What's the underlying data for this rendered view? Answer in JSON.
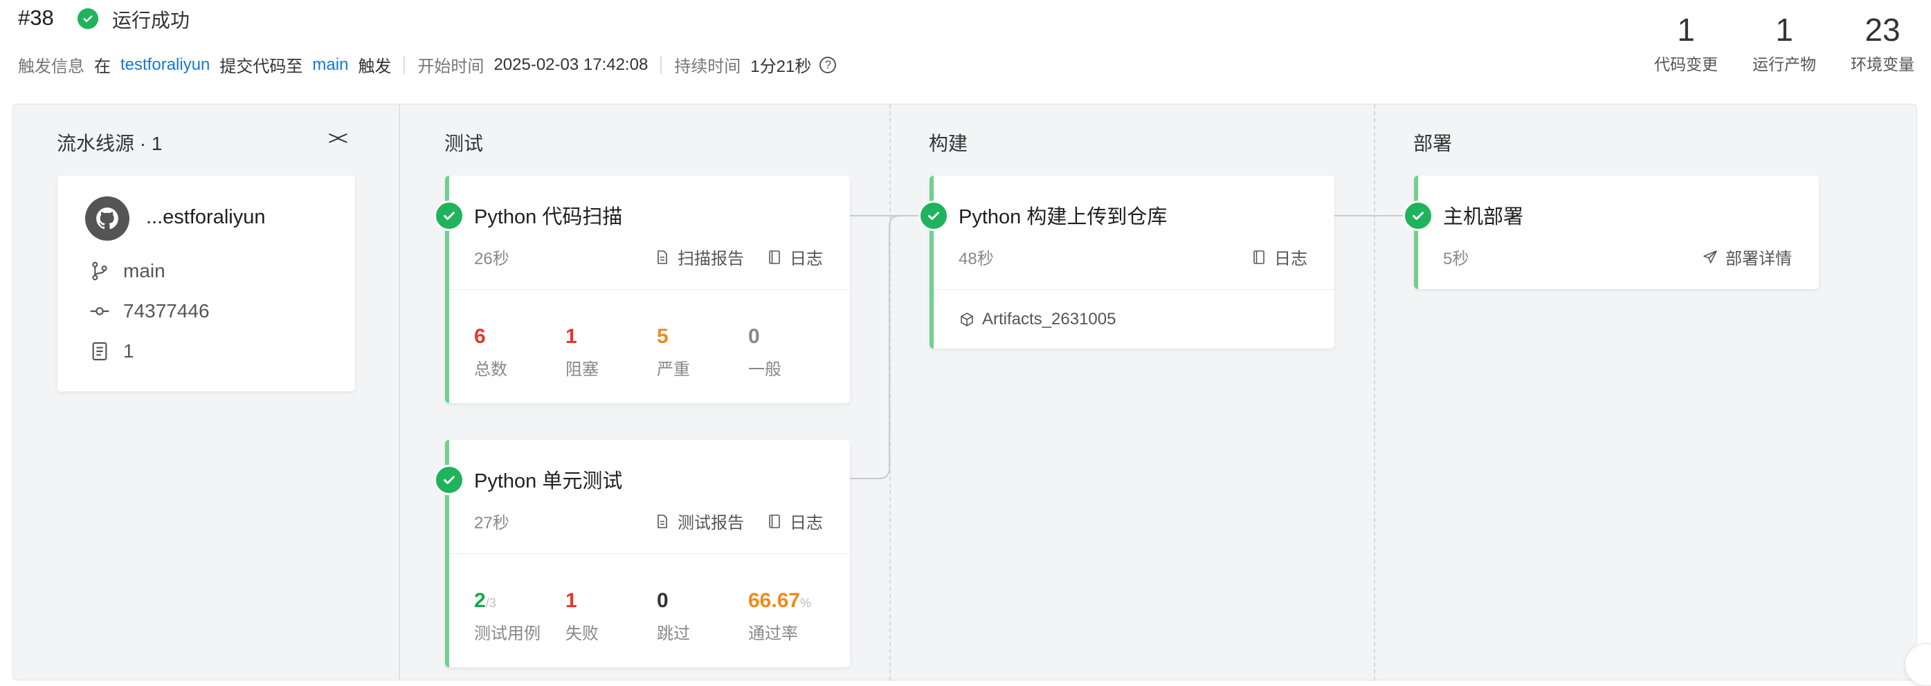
{
  "header": {
    "run_number": "#38",
    "status": "运行成功",
    "trigger_label": "触发信息",
    "trigger_prefix": "在",
    "trigger_repo": "testforaliyun",
    "trigger_middle": "提交代码至",
    "trigger_branch": "main",
    "trigger_suffix": "触发",
    "start_label": "开始时间",
    "start_time": "2025-02-03 17:42:08",
    "duration_label": "持续时间",
    "duration": "1分21秒",
    "help_glyph": "?",
    "stats": [
      {
        "value": "1",
        "label": "代码变更"
      },
      {
        "value": "1",
        "label": "运行产物"
      },
      {
        "value": "23",
        "label": "环境变量"
      }
    ]
  },
  "source": {
    "title": "流水线源 · 1",
    "collapse_glyph": "><",
    "repo_name": "...estforaliyun",
    "branch": "main",
    "commit": "74377446",
    "count": "1"
  },
  "stages": [
    {
      "title": "测试",
      "jobs": [
        {
          "name": "Python 代码扫描",
          "duration": "26秒",
          "actions": [
            "扫描报告",
            "日志"
          ],
          "metrics": [
            {
              "value": "6",
              "label": "总数",
              "color": "#e8352b"
            },
            {
              "value": "1",
              "label": "阻塞",
              "color": "#e8352b"
            },
            {
              "value": "5",
              "label": "严重",
              "color": "#f08a1d"
            },
            {
              "value": "0",
              "label": "一般",
              "color": "#888888"
            }
          ]
        },
        {
          "name": "Python 单元测试",
          "duration": "27秒",
          "actions": [
            "测试报告",
            "日志"
          ],
          "metrics": [
            {
              "value": "2",
              "suffix": "/3",
              "label": "测试用例",
              "color": "#1aa64a"
            },
            {
              "value": "1",
              "label": "失败",
              "color": "#e8352b"
            },
            {
              "value": "0",
              "label": "跳过",
              "color": "#333333"
            },
            {
              "value": "66.67",
              "suffix": "%",
              "label": "通过率",
              "color": "#f08a1d"
            }
          ]
        }
      ]
    },
    {
      "title": "构建",
      "jobs": [
        {
          "name": "Python 构建上传到仓库",
          "duration": "48秒",
          "actions": [
            "日志"
          ],
          "artifact": "Artifacts_2631005"
        }
      ]
    },
    {
      "title": "部署",
      "jobs": [
        {
          "name": "主机部署",
          "duration": "5秒",
          "actions": [
            "部署详情"
          ]
        }
      ]
    }
  ],
  "colors": {
    "success": "#1fb35c",
    "accent_link": "#1677d9",
    "stage_bar": "#6fd08c"
  }
}
